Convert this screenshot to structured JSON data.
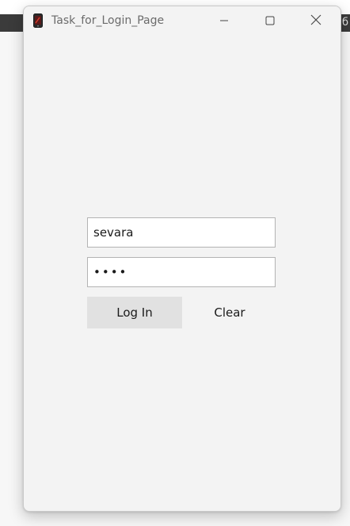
{
  "background": {
    "right_edge_text": "лб"
  },
  "window": {
    "title": "Task_for_Login_Page",
    "icons": {
      "app": "phone-icon",
      "minimize": "minimize-icon",
      "maximize": "maximize-icon",
      "close": "close-icon"
    }
  },
  "form": {
    "username_value": "sevara",
    "password_value": "••••",
    "login_label": "Log In",
    "clear_label": "Clear"
  },
  "colors": {
    "window_bg": "#f3f3f3",
    "login_button_bg": "#e1e1e1",
    "field_border": "#b3b3b3"
  }
}
